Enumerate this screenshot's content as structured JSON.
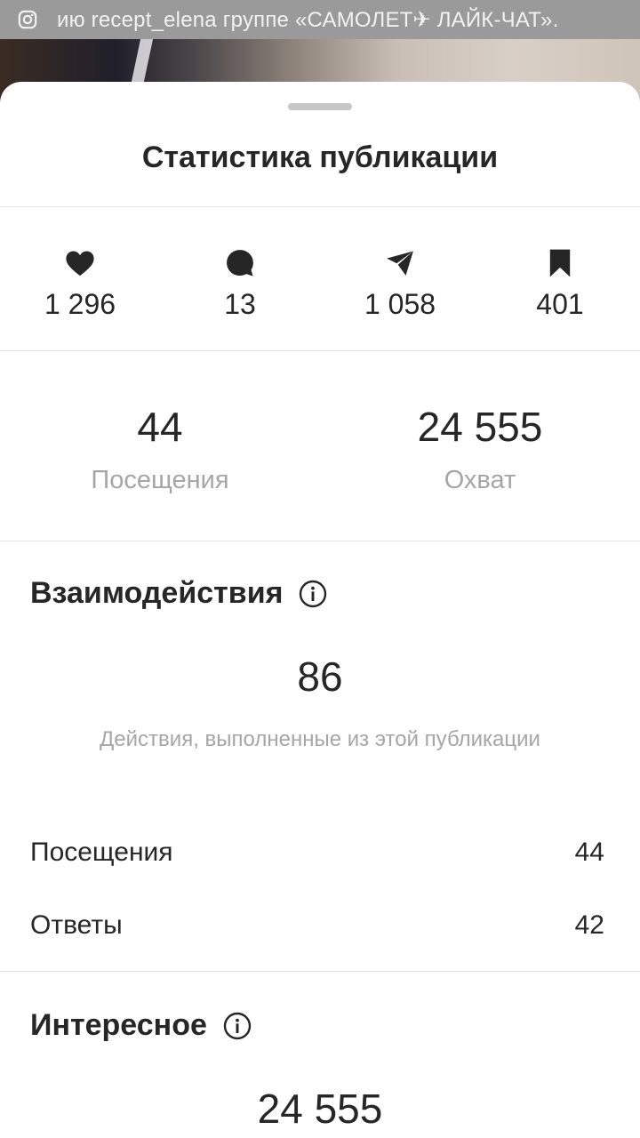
{
  "notification": {
    "icon": "instagram-icon",
    "text": "ию recept_elena группе «САМОЛЕТ✈ ЛАЙК-ЧАТ»."
  },
  "sheet": {
    "title": "Статистика публикации"
  },
  "metrics": [
    {
      "icon": "heart-icon",
      "value": "1 296"
    },
    {
      "icon": "comment-icon",
      "value": "13"
    },
    {
      "icon": "share-icon",
      "value": "1 058"
    },
    {
      "icon": "bookmark-icon",
      "value": "401"
    }
  ],
  "summary": {
    "visits": {
      "value": "44",
      "label": "Посещения"
    },
    "reach": {
      "value": "24 555",
      "label": "Охват"
    }
  },
  "interactions": {
    "title": "Взаимодействия",
    "total": "86",
    "description": "Действия, выполненные из этой публикации",
    "rows": [
      {
        "label": "Посещения",
        "value": "44"
      },
      {
        "label": "Ответы",
        "value": "42"
      }
    ]
  },
  "discovery": {
    "title": "Интересное",
    "total": "24 555"
  },
  "colors": {
    "text": "#262626",
    "muted": "#a6a6a6",
    "divider": "#e3e3e3",
    "notification_bg": "#9a9a9a"
  }
}
